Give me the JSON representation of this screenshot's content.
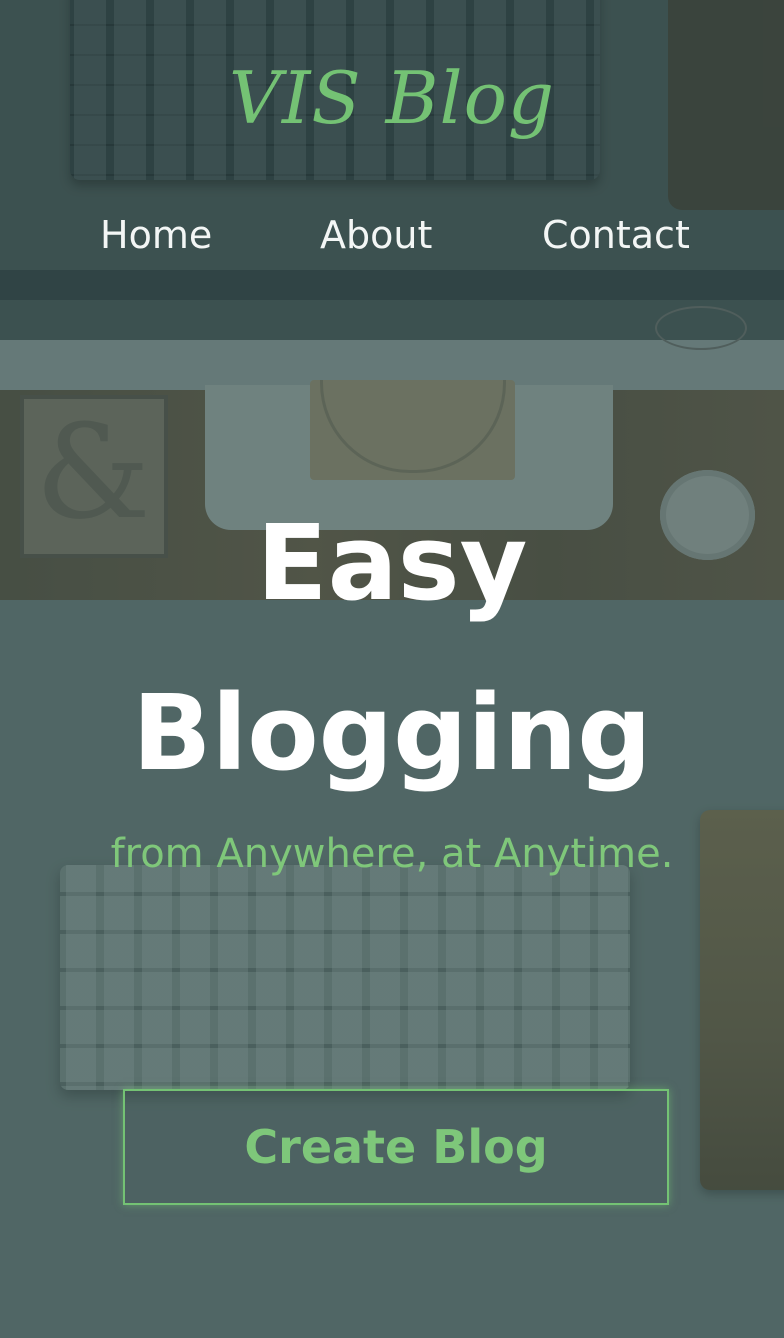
{
  "header": {
    "brand": "VIS Blog"
  },
  "nav": {
    "items": [
      {
        "label": "Home"
      },
      {
        "label": "About"
      },
      {
        "label": "Contact"
      }
    ]
  },
  "hero": {
    "title_line1": "Easy",
    "title_line2": "Blogging",
    "subtitle": "from Anywhere, at Anytime.",
    "cta_label": "Create Blog"
  },
  "colors": {
    "accent_green": "#74c274",
    "text_white": "#ffffff",
    "overlay": "#3c5856"
  }
}
